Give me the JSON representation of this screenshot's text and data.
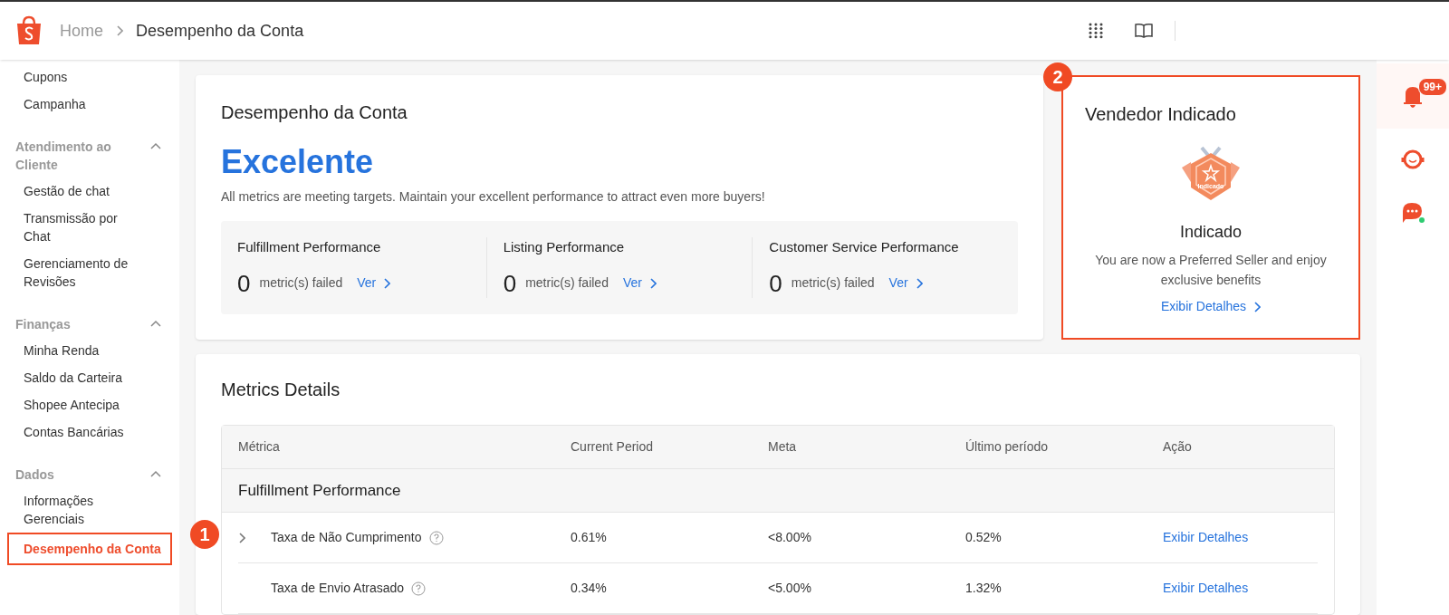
{
  "header": {
    "breadcrumb": [
      "Home",
      "Desempenho da Conta"
    ]
  },
  "sidebar": {
    "top_items": [
      {
        "label": "Cupons",
        "selected": false
      },
      {
        "label": "Campanha",
        "selected": false
      }
    ],
    "sections": [
      {
        "title": "Atendimento ao Cliente",
        "expanded": true,
        "items": [
          {
            "label": "Gestão de chat",
            "selected": false
          },
          {
            "label": "Transmissão por Chat",
            "selected": false
          },
          {
            "label": "Gerenciamento de Revisões",
            "selected": false
          }
        ]
      },
      {
        "title": "Finanças",
        "expanded": true,
        "items": [
          {
            "label": "Minha Renda",
            "selected": false
          },
          {
            "label": "Saldo da Carteira",
            "selected": false
          },
          {
            "label": "Shopee Antecipa",
            "selected": false
          },
          {
            "label": "Contas Bancárias",
            "selected": false
          }
        ]
      },
      {
        "title": "Dados",
        "expanded": true,
        "items": [
          {
            "label": "Informações Gerenciais",
            "selected": false
          },
          {
            "label": "Desempenho da Conta",
            "selected": true,
            "callout": "1"
          }
        ]
      }
    ]
  },
  "performance": {
    "title": "Desempenho da Conta",
    "rating": "Excelente",
    "message": "All metrics are meeting targets. Maintain your excellent performance to attract even more buyers!",
    "groups": [
      {
        "title": "Fulfillment Performance",
        "count": "0",
        "label": "metric(s) failed",
        "link": "Ver"
      },
      {
        "title": "Listing Performance",
        "count": "0",
        "label": "metric(s) failed",
        "link": "Ver"
      },
      {
        "title": "Customer Service Performance",
        "count": "0",
        "label": "metric(s) failed",
        "link": "Ver"
      }
    ]
  },
  "seller": {
    "callout": "2",
    "title": "Vendedor Indicado",
    "badge_text": "Indicado",
    "status": "Indicado",
    "message": "You are now a Preferred Seller and enjoy exclusive benefits",
    "link": "Exibir Detalhes"
  },
  "metrics": {
    "title": "Metrics Details",
    "columns": [
      "Métrica",
      "Current Period",
      "Meta",
      "Último período",
      "Ação"
    ],
    "section": "Fulfillment Performance",
    "rows": [
      {
        "name": "Taxa de Não Cumprimento",
        "expandable": true,
        "current": "0.61%",
        "target": "<8.00%",
        "last": "0.52%",
        "action": "Exibir Detalhes"
      },
      {
        "name": "Taxa de Envio Atrasado",
        "expandable": false,
        "current": "0.34%",
        "target": "<5.00%",
        "last": "1.32%",
        "action": "Exibir Detalhes"
      }
    ]
  },
  "right_rail": {
    "notification_count": "99+"
  }
}
